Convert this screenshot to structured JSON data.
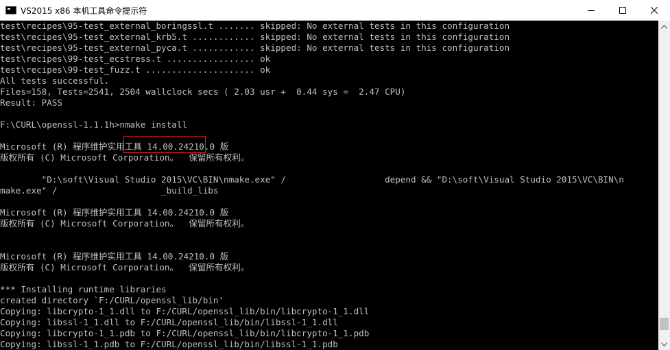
{
  "window": {
    "title": "VS2015 x86 本机工具命令提示符"
  },
  "console": {
    "lines": [
      "test\\recipes\\95-test_external_boringssl.t ....... skipped: No external tests in this configuration",
      "test\\recipes\\95-test_external_krb5.t ............ skipped: No external tests in this configuration",
      "test\\recipes\\95-test_external_pyca.t ............ skipped: No external tests in this configuration",
      "test\\recipes\\99-test_ecstress.t ................. ok",
      "test\\recipes\\99-test_fuzz.t ..................... ok",
      "All tests successful.",
      "Files=158, Tests=2541, 2504 wallclock secs ( 2.03 usr +  0.44 sys =  2.47 CPU)",
      "Result: PASS",
      "",
      "F:\\CURL\\openssl-1.1.1h>nmake install",
      "",
      "Microsoft (R) 程序维护实用工具 14.00.24210.0 版",
      "版权所有 (C) Microsoft Corporation。  保留所有权利。",
      "",
      "        \"D:\\soft\\Visual Studio 2015\\VC\\BIN\\nmake.exe\" /                   depend && \"D:\\soft\\Visual Studio 2015\\VC\\BIN\\n",
      "make.exe\" /                    _build_libs",
      "",
      "Microsoft (R) 程序维护实用工具 14.00.24210.0 版",
      "版权所有 (C) Microsoft Corporation。  保留所有权利。",
      "",
      "",
      "Microsoft (R) 程序维护实用工具 14.00.24210.0 版",
      "版权所有 (C) Microsoft Corporation。  保留所有权利。",
      "",
      "*** Installing runtime libraries",
      "created directory `F:/CURL/openssl_lib/bin'",
      "Copying: libcrypto-1_1.dll to F:/CURL/openssl_lib/bin/libcrypto-1_1.dll",
      "Copying: libssl-1_1.dll to F:/CURL/openssl_lib/bin/libssl-1_1.dll",
      "Copying: libcrypto-1_1.pdb to F:/CURL/openssl_lib/bin/libcrypto-1_1.pdb",
      "Copying: libssl-1_1.pdb to F:/CURL/openssl_lib/bin/libssl-1_1.pdb"
    ]
  },
  "colors": {
    "console_bg": "#000000",
    "console_text": "#c0c0c0",
    "highlight": "#e02020"
  },
  "icons": {
    "app": "console-app-icon",
    "minimize": "minimize-icon",
    "maximize": "maximize-icon",
    "close": "close-icon"
  }
}
